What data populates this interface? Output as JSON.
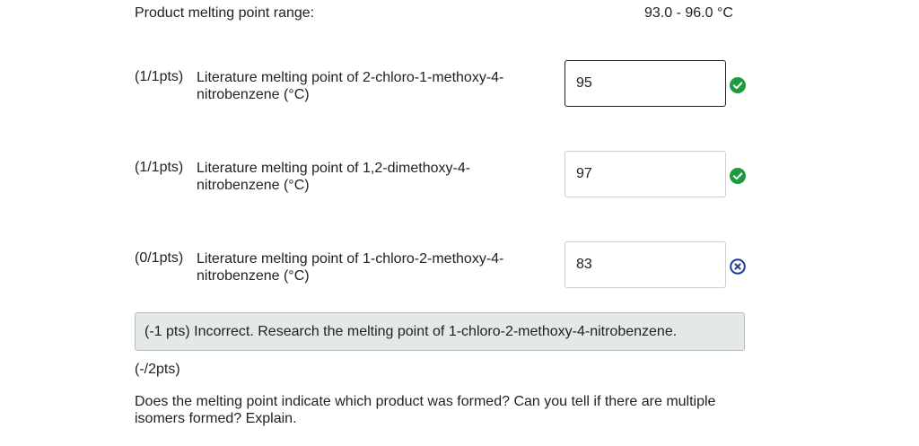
{
  "summary": {
    "range_label": "Product melting point range:",
    "range_value": "93.0 - 96.0 °C"
  },
  "questions": [
    {
      "points": "(1/1pts)",
      "text": "Literature melting point of 2-chloro-1-methoxy-4-nitrobenzene (°C)",
      "answer": "95",
      "status": "correct",
      "status_icon": "check-circle-icon"
    },
    {
      "points": "(1/1pts)",
      "text": "Literature melting point of 1,2-dimethoxy-4-nitrobenzene (°C)",
      "answer": "97",
      "status": "correct",
      "status_icon": "check-circle-icon"
    },
    {
      "points": "(0/1pts)",
      "text": "Literature melting point of 1-chloro-2-methoxy-4-nitrobenzene (°C)",
      "answer": "83",
      "status": "incorrect",
      "status_icon": "x-circle-icon"
    }
  ],
  "feedback": {
    "text": "(-1 pts) Incorrect. Research the melting point of 1-chloro-2-methoxy-4-nitrobenzene."
  },
  "next_question": {
    "points": "(-/2pts)",
    "text": "Does the melting point indicate which product was formed? Can you tell if there are multiple isomers formed? Explain."
  },
  "colors": {
    "correct": "#1e9b3e",
    "incorrect": "#1f3a8f",
    "feedback_bg": "#e4e8e6",
    "feedback_border": "#b5bfba"
  }
}
